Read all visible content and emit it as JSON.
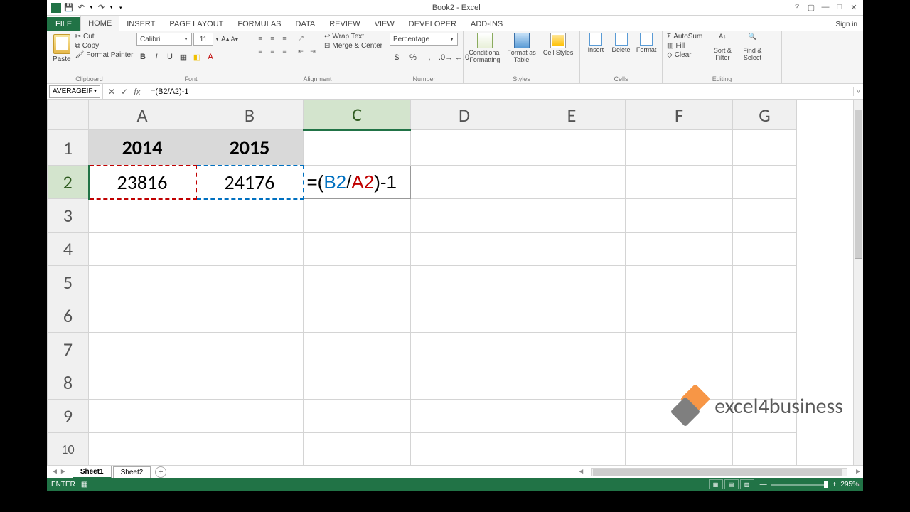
{
  "window": {
    "title": "Book2 - Excel",
    "signin": "Sign in"
  },
  "qat": {
    "undo": "↶",
    "redo": "↷"
  },
  "tabs": {
    "file": "FILE",
    "home": "HOME",
    "insert": "INSERT",
    "pagelayout": "PAGE LAYOUT",
    "formulas": "FORMULAS",
    "data": "DATA",
    "review": "REVIEW",
    "view": "VIEW",
    "developer": "DEVELOPER",
    "addins": "ADD-INS"
  },
  "ribbon": {
    "clipboard": {
      "label": "Clipboard",
      "paste": "Paste",
      "cut": "Cut",
      "copy": "Copy",
      "painter": "Format Painter"
    },
    "font": {
      "label": "Font",
      "name": "Calibri",
      "size": "11"
    },
    "alignment": {
      "label": "Alignment",
      "wrap": "Wrap Text",
      "merge": "Merge & Center"
    },
    "number": {
      "label": "Number",
      "format": "Percentage"
    },
    "styles": {
      "label": "Styles",
      "cond": "Conditional Formatting",
      "table": "Format as Table",
      "cell": "Cell Styles"
    },
    "cells": {
      "label": "Cells",
      "insert": "Insert",
      "delete": "Delete",
      "format": "Format"
    },
    "editing": {
      "label": "Editing",
      "autosum": "AutoSum",
      "fill": "Fill",
      "clear": "Clear",
      "sort": "Sort & Filter",
      "find": "Find & Select"
    }
  },
  "fbar": {
    "name": "AVERAGEIF",
    "formula": "=(B2/A2)-1"
  },
  "cols": [
    "A",
    "B",
    "C",
    "D",
    "E",
    "F",
    "G"
  ],
  "rows": [
    "1",
    "2",
    "3",
    "4",
    "5",
    "6",
    "7",
    "8",
    "9",
    "10"
  ],
  "data": {
    "A1": "2014",
    "B1": "2015",
    "A2": "23816",
    "B2": "24176",
    "C2_prefix": "=(",
    "C2_b": "B2",
    "C2_mid": "/",
    "C2_r": "A2",
    "C2_suffix": ")-1"
  },
  "watermark": "excel4business",
  "sheets": {
    "s1": "Sheet1",
    "s2": "Sheet2"
  },
  "status": {
    "mode": "ENTER",
    "zoom": "295%"
  },
  "chart_data": {
    "type": "table",
    "columns": [
      "2014",
      "2015"
    ],
    "rows": [
      [
        23816,
        24176
      ]
    ],
    "formula_C2": "=(B2/A2)-1"
  }
}
